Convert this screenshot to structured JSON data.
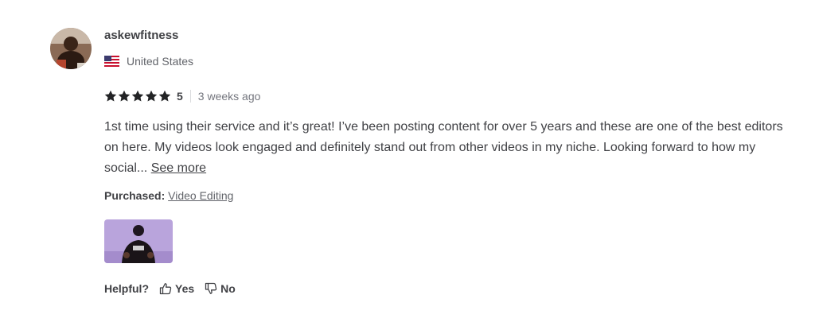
{
  "review": {
    "username": "askewfitness",
    "country": "United States",
    "flag_icon": "us-flag-icon",
    "rating": "5",
    "stars_filled": 5,
    "time_ago": "3 weeks ago",
    "text": "1st time using their service and it’s great! I’ve been posting content for over 5 years and these are one of the best editors on here. My videos look engaged and definitely stand out from other videos in my niche. Looking forward to how my social...",
    "see_more_label": "See more",
    "purchased_label": "Purchased:",
    "purchased_item": "Video Editing",
    "helpful_label": "Helpful?",
    "yes_label": "Yes",
    "no_label": "No"
  },
  "colors": {
    "text": "#404145",
    "muted": "#74767e",
    "star": "#222325",
    "thumbnail_bg": "#b9a4dc"
  }
}
